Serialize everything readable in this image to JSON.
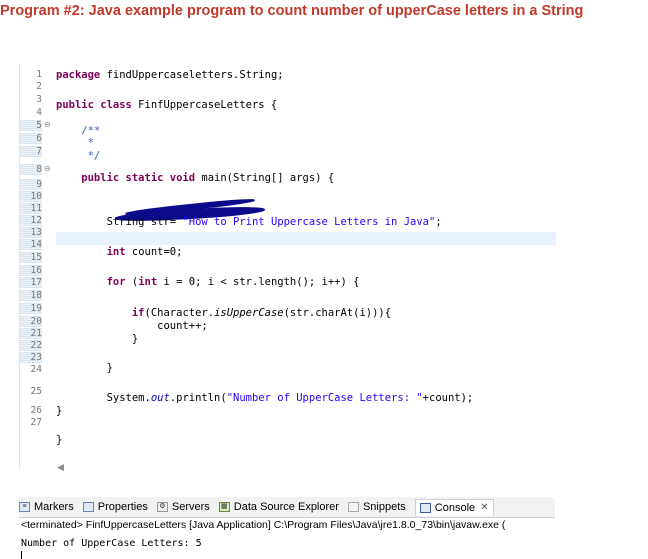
{
  "heading": "Program #2: Java example program to count number of upperCase letters in a String",
  "editor": {
    "line_numbers": [
      "1",
      "2",
      "3",
      "4",
      "5",
      "6",
      "7",
      "8",
      "9",
      "10",
      "11",
      "12",
      "13",
      "14",
      "15",
      "16",
      "17",
      "18",
      "19",
      "20",
      "21",
      "22",
      "23",
      "24",
      "25",
      "26",
      "27"
    ],
    "code": {
      "l1_kw": "package",
      "l1_rest": " findUppercaseletters.String;",
      "l3_kw": "public class",
      "l3_rest": " FinfUppercaseLetters {",
      "l5_cmt": "    /**",
      "l6_cmt": "     * ",
      "l7_cmt": "     */",
      "l8_kw": "    public static void",
      "l8_rest": " main(String[] args) {",
      "l11_a": "        String str= ",
      "l11_str": "\"How to Print Uppercase Letters in Java\"",
      "l11_b": ";",
      "l13_kw": "        int",
      "l13_rest": " count=0;",
      "l15_kw1": "        for",
      "l15_a": " (",
      "l15_kw2": "int",
      "l15_b": " i = 0; i < str.length(); i++) {",
      "l17_kw": "            if",
      "l17_a": "(Character.",
      "l17_it": "isUpperCase",
      "l17_b": "(str.charAt(i))){",
      "l18": "                count++;",
      "l19": "            }",
      "l21": "        }",
      "l23_a": "        System.",
      "l23_fld": "out",
      "l23_b": ".println(",
      "l23_str": "\"Number of UpperCase Letters: \"",
      "l23_c": "+count);",
      "l24": "}",
      "l26": "}"
    }
  },
  "console_panel": {
    "tabs": [
      {
        "label": "Markers",
        "icon": "markers-icon"
      },
      {
        "label": "Properties",
        "icon": "properties-icon"
      },
      {
        "label": "Servers",
        "icon": "servers-icon"
      },
      {
        "label": "Data Source Explorer",
        "icon": "data-source-icon"
      },
      {
        "label": "Snippets",
        "icon": "snippets-icon"
      },
      {
        "label": "Console",
        "icon": "console-icon"
      }
    ],
    "terminated_line": "<terminated> FinfUppercaseLetters [Java Application] C:\\Program Files\\Java\\jre1.8.0_73\\bin\\javaw.exe (",
    "output": "Number of UpperCase Letters: 5"
  }
}
